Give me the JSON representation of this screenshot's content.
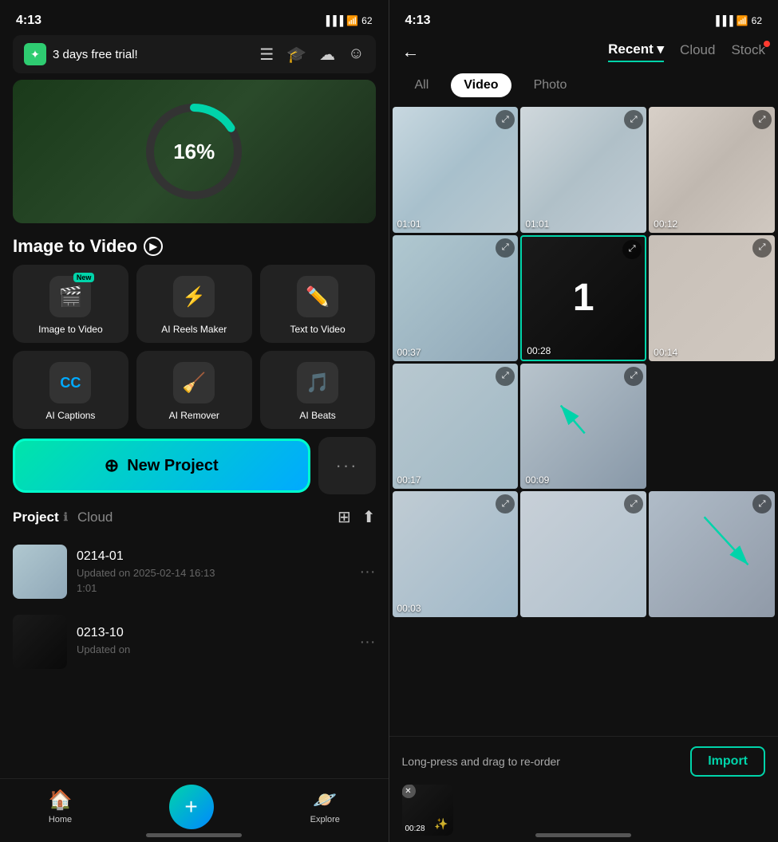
{
  "left": {
    "statusBar": {
      "time": "4:13",
      "battery": "62"
    },
    "trialBanner": {
      "label": "3 days free trial!",
      "icon": "✦"
    },
    "hero": {
      "percent": "16%"
    },
    "sectionTitle": "Image to Video",
    "tools": [
      {
        "id": "image-to-video",
        "label": "Image to Video",
        "icon": "🎬",
        "badge": "New"
      },
      {
        "id": "ai-reels",
        "label": "AI Reels Maker",
        "icon": "⚡",
        "badge": ""
      },
      {
        "id": "text-to-video",
        "label": "Text  to Video",
        "icon": "✏️",
        "badge": ""
      },
      {
        "id": "ai-captions",
        "label": "AI Captions",
        "icon": "CC",
        "badge": ""
      },
      {
        "id": "ai-remover",
        "label": "AI Remover",
        "icon": "🧹",
        "badge": ""
      },
      {
        "id": "ai-beats",
        "label": "AI Beats",
        "icon": "🎵",
        "badge": ""
      }
    ],
    "newProjectBtn": "New Project",
    "moreBtn": "···",
    "projects": {
      "title": "Project",
      "cloudLabel": "Cloud",
      "items": [
        {
          "name": "0214-01",
          "date": "Updated on 2025-02-14 16:13",
          "duration": "1:01"
        },
        {
          "name": "0213-10",
          "date": "Updated on",
          "duration": ""
        }
      ]
    },
    "bottomNav": {
      "home": "Home",
      "explore": "Explore"
    }
  },
  "right": {
    "statusBar": {
      "time": "4:13",
      "battery": "62"
    },
    "header": {
      "backIcon": "←",
      "tabs": [
        {
          "id": "recent",
          "label": "Recent",
          "active": true,
          "hasDropdown": true
        },
        {
          "id": "cloud",
          "label": "Cloud",
          "active": false
        },
        {
          "id": "stock",
          "label": "Stock",
          "active": false,
          "hasDot": true
        }
      ]
    },
    "filterTabs": [
      {
        "id": "all",
        "label": "All",
        "active": false
      },
      {
        "id": "video",
        "label": "Video",
        "active": true
      },
      {
        "id": "photo",
        "label": "Photo",
        "active": false
      }
    ],
    "mediaItems": [
      {
        "id": 1,
        "duration": "01:01",
        "bg": "bg-beach1"
      },
      {
        "id": 2,
        "duration": "01:01",
        "bg": "bg-beach2"
      },
      {
        "id": 3,
        "duration": "00:12",
        "bg": "bg-beach3"
      },
      {
        "id": 4,
        "duration": "00:37",
        "bg": "bg-beach4"
      },
      {
        "id": 5,
        "duration": "00:28",
        "bg": "bg-beach5",
        "selected": true,
        "selectNum": "1"
      },
      {
        "id": 6,
        "duration": "00:14",
        "bg": "bg-beach6"
      },
      {
        "id": 7,
        "duration": "00:17",
        "bg": "bg-beach7"
      },
      {
        "id": 8,
        "duration": "00:09",
        "bg": "bg-beach8"
      },
      {
        "id": 9,
        "duration": "00:03",
        "bg": "bg-beach9"
      },
      {
        "id": 10,
        "duration": "",
        "bg": "bg-beach10"
      },
      {
        "id": 11,
        "duration": "",
        "bg": "bg-beach11"
      },
      {
        "id": 12,
        "duration": "",
        "bg": "bg-beach12"
      }
    ],
    "bottomBar": {
      "hint": "Long-press and drag to re-order",
      "importBtn": "Import",
      "selectedItem": {
        "duration": "00:28"
      }
    }
  }
}
